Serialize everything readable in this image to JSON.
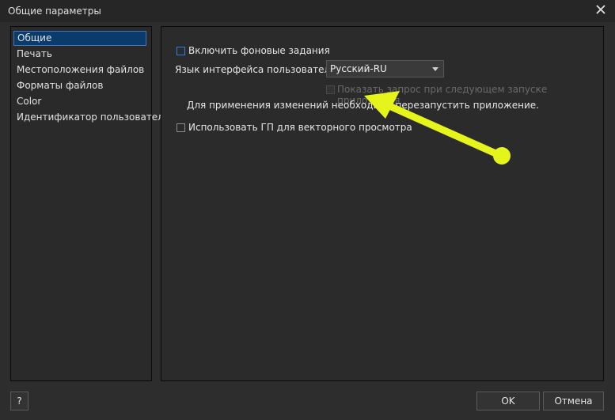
{
  "window": {
    "title": "Общие параметры"
  },
  "sidebar": {
    "items": [
      {
        "label": "Общие",
        "selected": true
      },
      {
        "label": "Печать"
      },
      {
        "label": "Местоположения файлов"
      },
      {
        "label": "Форматы файлов"
      },
      {
        "label": "Color"
      },
      {
        "label": "Идентификатор пользователя"
      }
    ]
  },
  "general": {
    "background_jobs_label": "Включить фоновые задания",
    "background_jobs_checked": false,
    "ui_language_label": "Язык интерфейса пользователя:",
    "ui_language_value": "Русский-RU",
    "show_prompt_label": "Показать запрос при следующем запуске приложения",
    "restart_note": "Для применения изменений необходимо перезапустить приложение.",
    "gpu_vector_label": "Использовать ГП для векторного просмотра",
    "gpu_vector_checked": false
  },
  "footer": {
    "help_label": "?",
    "ok_label": "OK",
    "cancel_label": "Отмена"
  },
  "annotation": {
    "arrow_color": "#e5f51b"
  }
}
